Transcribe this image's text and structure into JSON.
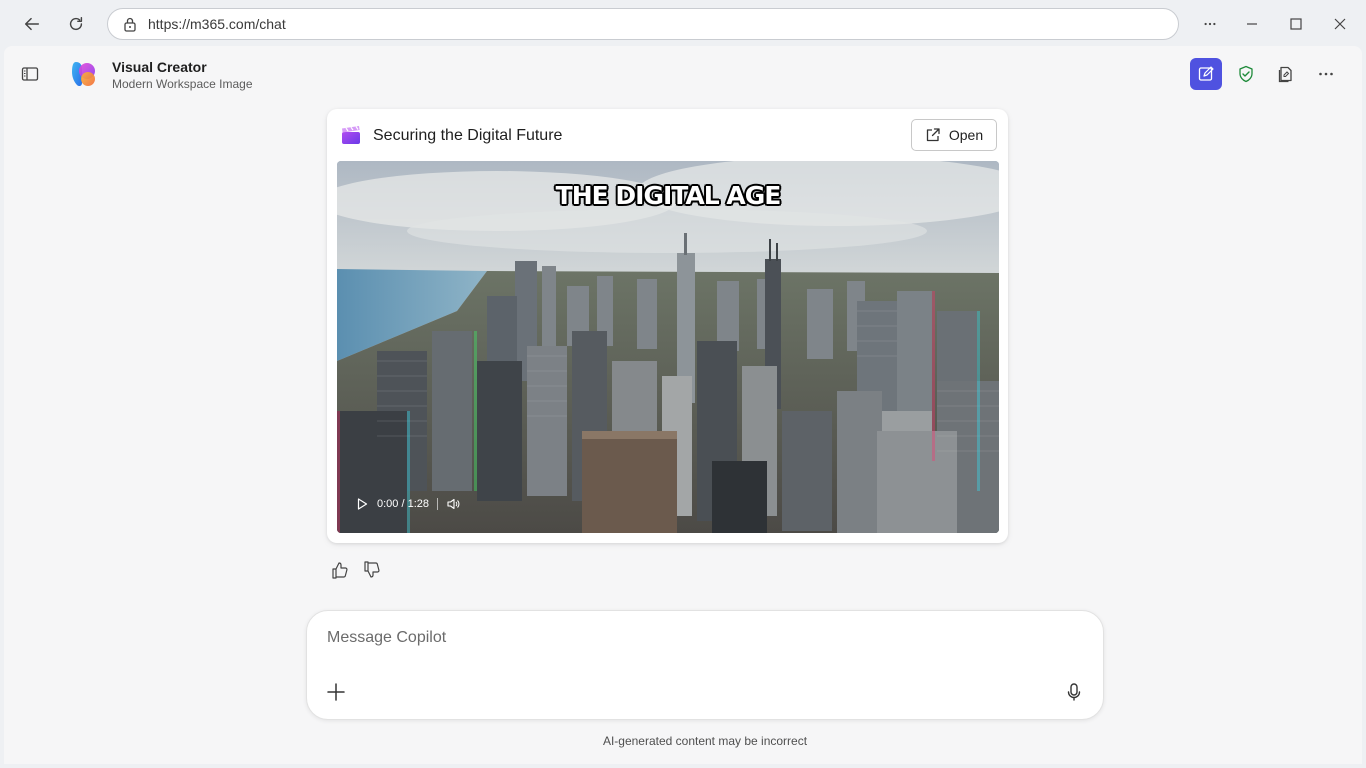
{
  "browser": {
    "url": "https://m365.com/chat",
    "icons": [
      "back-icon",
      "refresh-icon",
      "lock-icon",
      "more-icon",
      "minimize-icon",
      "maximize-icon",
      "close-icon"
    ]
  },
  "app": {
    "title": "Visual Creator",
    "subtitle": "Modern Workspace Image",
    "actions": [
      "new-chat-icon",
      "shield-check-icon",
      "notebook-icon",
      "more-icon"
    ],
    "accent_color": "#4f52e0"
  },
  "card": {
    "title": "Securing the Digital Future",
    "open_label": "Open",
    "video": {
      "overlay_title": "THE DIGITAL AGE",
      "time": "0:00 / 1:28"
    }
  },
  "feedback": {
    "icons": [
      "thumbs-up-icon",
      "thumbs-down-icon"
    ]
  },
  "composer": {
    "placeholder": "Message Copilot",
    "disclaimer": "AI-generated content may be incorrect"
  }
}
